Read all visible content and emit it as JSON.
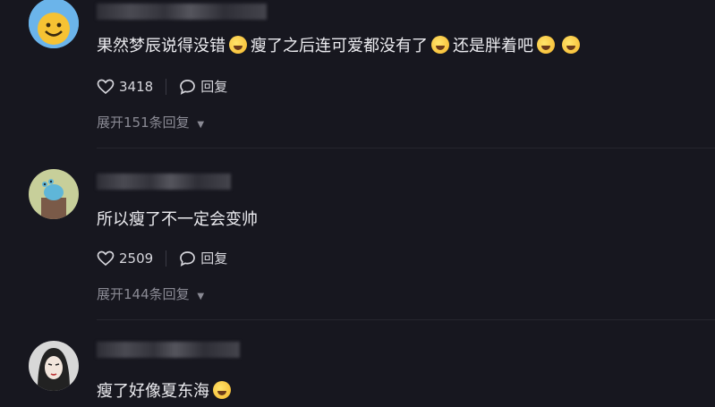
{
  "comments": [
    {
      "name": "",
      "text_parts": [
        "果然梦辰说得没错",
        "瘦了之后连可爱都没有了",
        "还是胖着吧",
        ""
      ],
      "likes": "3418",
      "reply_label": "回复",
      "expand_label": "展开151条回复"
    },
    {
      "name": "",
      "text": "所以瘦了不一定会变帅",
      "likes": "2509",
      "reply_label": "回复",
      "expand_label": "展开144条回复"
    },
    {
      "name": "",
      "text": "瘦了好像夏东海"
    }
  ]
}
